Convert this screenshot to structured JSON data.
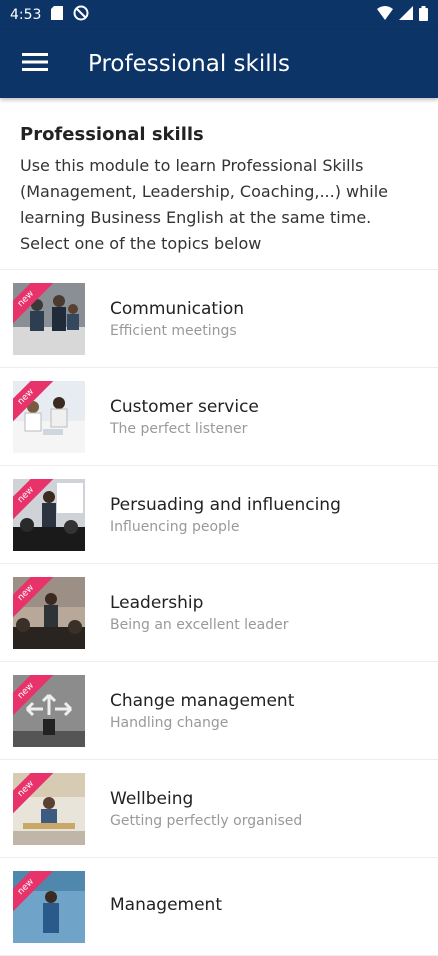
{
  "status_bar": {
    "time": "4:53"
  },
  "app_bar": {
    "title": "Professional skills"
  },
  "intro": {
    "heading": "Professional skills",
    "line1": "Use this module to learn Professional Skills",
    "line2": "(Management, Leadership, Coaching,...) while",
    "line3": "learning Business English at the same time.",
    "line4": "Select one of the topics below"
  },
  "badge": "new",
  "topics": [
    {
      "title": "Communication",
      "subtitle": "Efficient meetings"
    },
    {
      "title": "Customer service",
      "subtitle": "The perfect listener"
    },
    {
      "title": "Persuading and influencing",
      "subtitle": "Influencing people"
    },
    {
      "title": "Leadership",
      "subtitle": "Being an excellent leader"
    },
    {
      "title": "Change management",
      "subtitle": "Handling change"
    },
    {
      "title": "Wellbeing",
      "subtitle": "Getting perfectly organised"
    },
    {
      "title": "Management",
      "subtitle": ""
    }
  ],
  "colors": {
    "brand": "#0d3466",
    "badge": "#e8336a"
  }
}
